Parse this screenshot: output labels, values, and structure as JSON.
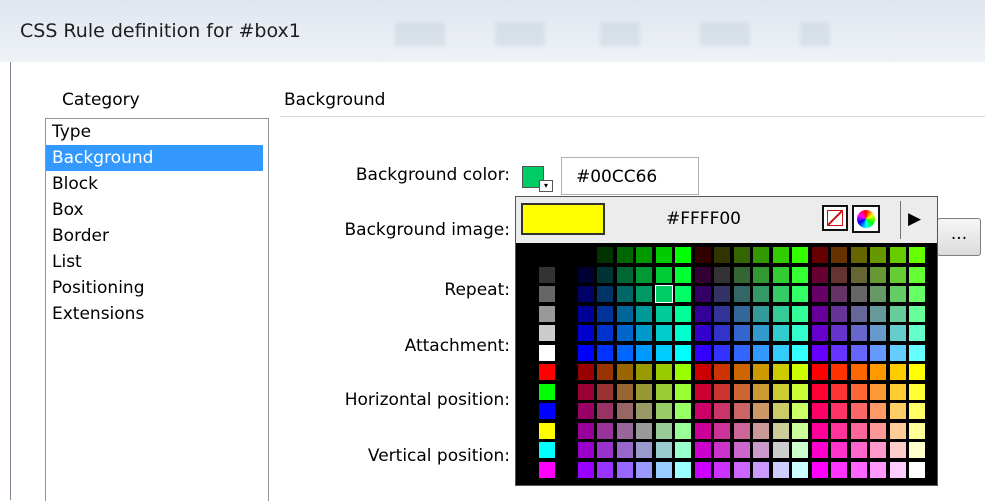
{
  "window": {
    "title": "CSS Rule definition for #box1"
  },
  "category": {
    "label": "Category",
    "items": [
      {
        "label": "Type",
        "selected": false
      },
      {
        "label": "Background",
        "selected": true
      },
      {
        "label": "Block",
        "selected": false
      },
      {
        "label": "Box",
        "selected": false
      },
      {
        "label": "Border",
        "selected": false
      },
      {
        "label": "List",
        "selected": false
      },
      {
        "label": "Positioning",
        "selected": false
      },
      {
        "label": "Extensions",
        "selected": false
      }
    ]
  },
  "section": {
    "title": "Background"
  },
  "fields": {
    "background_color": {
      "label": "Background color:",
      "value": "#00CC66",
      "swatch": "#00cc66"
    },
    "background_image": {
      "label": "Background image:",
      "browse_label": "..."
    },
    "repeat": {
      "label": "Repeat:"
    },
    "attachment": {
      "label": "Attachment:"
    },
    "horizontal_position": {
      "label": "Horizontal position:"
    },
    "vertical_position": {
      "label": "Vertical position:"
    }
  },
  "color_picker": {
    "preview_color": "#ffff00",
    "hex_value": "#FFFF00",
    "no_color_icon": "no-color-icon",
    "system_picker_icon": "color-wheel-icon",
    "menu_icon": "triangle-right-icon",
    "menu_glyph": "▶",
    "selected_color": "#00CC66"
  }
}
